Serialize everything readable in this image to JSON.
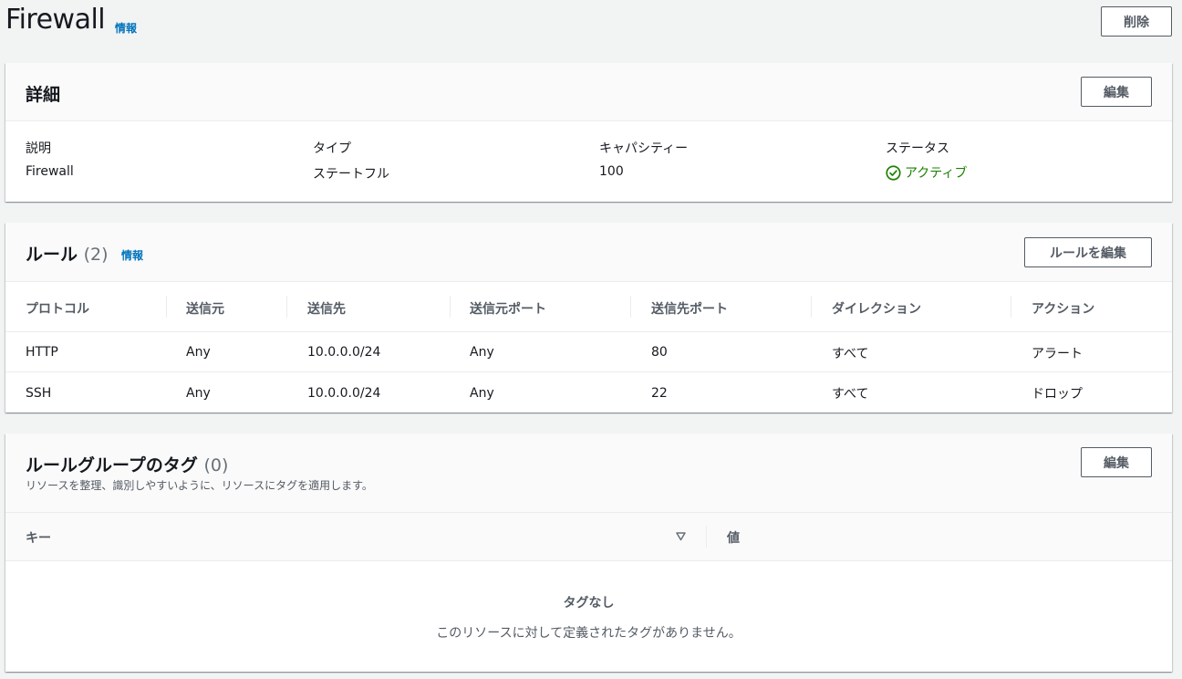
{
  "header": {
    "title": "Firewall",
    "info": "情報",
    "delete_label": "削除"
  },
  "details": {
    "title": "詳細",
    "edit_label": "編集",
    "fields": [
      {
        "label": "説明",
        "value": "Firewall"
      },
      {
        "label": "タイプ",
        "value": "ステートフル"
      },
      {
        "label": "キャパシティー",
        "value": "100"
      },
      {
        "label": "ステータス",
        "value": "アクティブ"
      }
    ],
    "status_color": "#1d8102",
    "status_icon": "check-circle-icon"
  },
  "rules": {
    "title": "ルール",
    "count": "(2)",
    "info": "情報",
    "edit_label": "ルールを編集",
    "columns": [
      "プロトコル",
      "送信元",
      "送信先",
      "送信元ポート",
      "送信先ポート",
      "ダイレクション",
      "アクション"
    ],
    "rows": [
      [
        "HTTP",
        "Any",
        "10.0.0.0/24",
        "Any",
        "80",
        "すべて",
        "アラート"
      ],
      [
        "SSH",
        "Any",
        "10.0.0.0/24",
        "Any",
        "22",
        "すべて",
        "ドロップ"
      ]
    ]
  },
  "tags": {
    "title": "ルールグループのタグ",
    "count": "(0)",
    "description": "リソースを整理、識別しやすいように、リソースにタグを適用します。",
    "edit_label": "編集",
    "columns": [
      "キー",
      "値"
    ],
    "sort_icon": "sort-down-triangle-icon",
    "empty_title": "タグなし",
    "empty_message": "このリソースに対して定義されたタグがありません。"
  },
  "colors": {
    "link": "#0073bb",
    "background": "#f2f3f3",
    "text": "#16191f"
  }
}
